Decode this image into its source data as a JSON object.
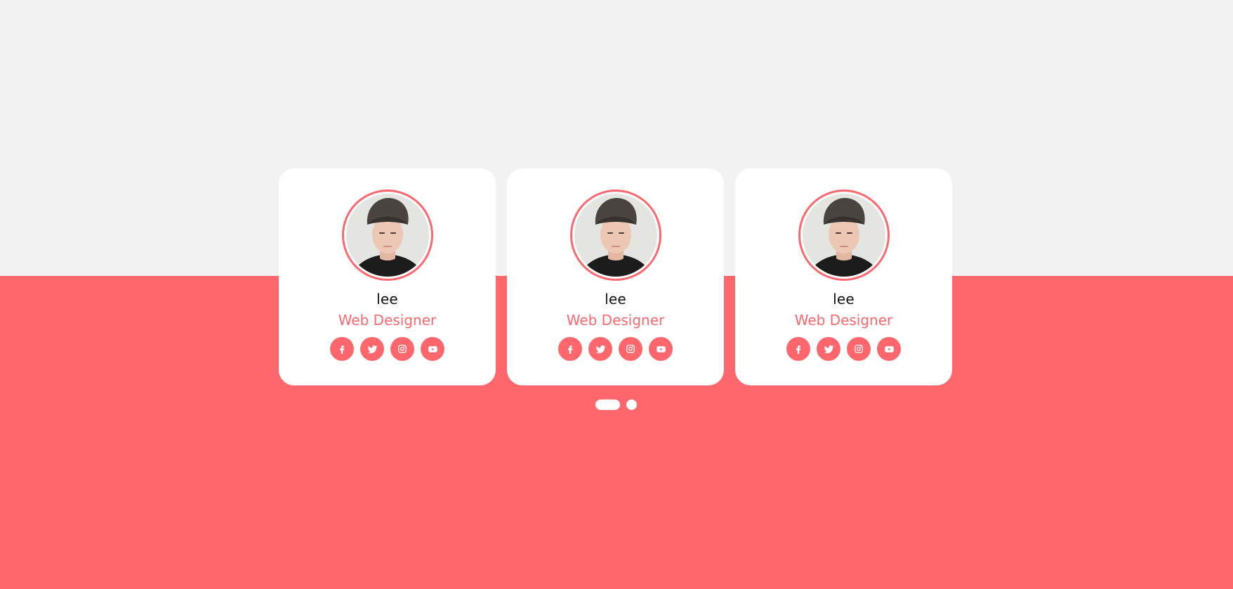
{
  "colors": {
    "accent": "#ff676d",
    "page_background_top": "#f2f2f2",
    "card_background": "#ffffff"
  },
  "cards": [
    {
      "name": "lee",
      "role": "Web Designer",
      "socials": [
        "facebook-icon",
        "twitter-icon",
        "instagram-icon",
        "youtube-icon"
      ]
    },
    {
      "name": "lee",
      "role": "Web Designer",
      "socials": [
        "facebook-icon",
        "twitter-icon",
        "instagram-icon",
        "youtube-icon"
      ]
    },
    {
      "name": "lee",
      "role": "Web Designer",
      "socials": [
        "facebook-icon",
        "twitter-icon",
        "instagram-icon",
        "youtube-icon"
      ]
    }
  ],
  "pagination": {
    "total_pages": 2,
    "active_page": 1
  }
}
